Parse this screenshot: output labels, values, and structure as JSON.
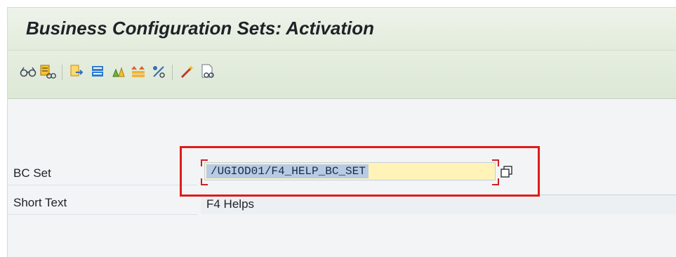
{
  "window": {
    "title": "Business Configuration Sets: Activation"
  },
  "toolbar": {
    "icons": [
      "display-glasses-icon",
      "display-details-icon",
      "transfer-icon",
      "bookmark-icon",
      "activate-icon",
      "list-icon",
      "percent-icon",
      "wizard-icon",
      "document-display-icon"
    ]
  },
  "form": {
    "bc_set": {
      "label": "BC Set",
      "value": "/UGIOD01/F4_HELP_BC_SET"
    },
    "short_text": {
      "label": "Short Text",
      "value": "F4 Helps"
    }
  },
  "colors": {
    "highlight_border": "#e01b1b",
    "input_background": "#fff3b8",
    "selection": "#b7cbe6"
  }
}
